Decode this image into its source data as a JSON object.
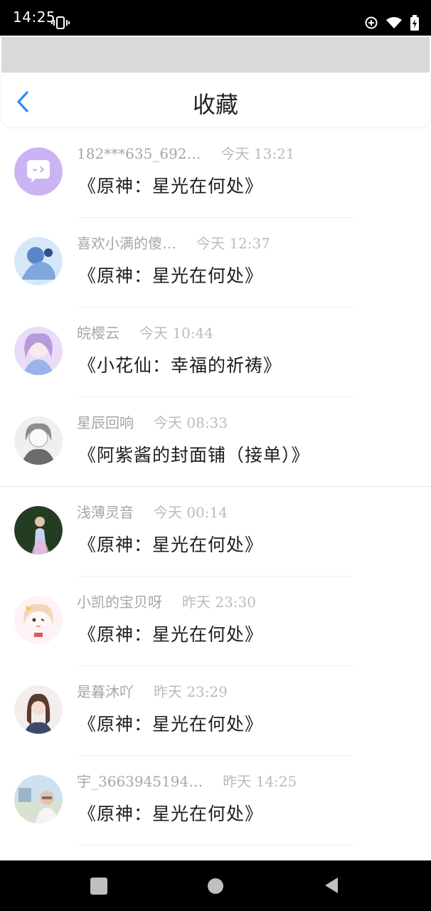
{
  "status_bar": {
    "time": "14:25"
  },
  "header": {
    "title": "收藏"
  },
  "items": [
    {
      "name": "182***635_692…",
      "time": "今天 13:21",
      "work": "《原神：星光在何处》",
      "avatar": "chat-bubble-avatar",
      "colors": [
        "#c9b3f2",
        "#ffffff"
      ]
    },
    {
      "name": "喜欢小满的傻…",
      "time": "今天 12:37",
      "work": "《原神：星光在何处》",
      "avatar": "anime-avatar",
      "colors": [
        "#cfe3f7",
        "#5a86c9"
      ]
    },
    {
      "name": "皖樱云",
      "time": "今天 10:44",
      "work": "《小花仙：幸福的祈祷》",
      "avatar": "anime-avatar",
      "colors": [
        "#e8d6f6",
        "#b59ad8"
      ]
    },
    {
      "name": "星辰回响",
      "time": "今天 08:33",
      "work": "《阿紫酱的封面铺（接单）》",
      "avatar": "anime-avatar",
      "colors": [
        "#ededed",
        "#8c8c8c"
      ]
    },
    {
      "name": "浅薄灵音",
      "time": "今天 00:14",
      "work": "《原神：星光在何处》",
      "avatar": "photo-avatar",
      "colors": [
        "#2e4a2a",
        "#b7c8e8"
      ]
    },
    {
      "name": "小凯的宝贝呀",
      "time": "昨天 23:30",
      "work": "《原神：星光在何处》",
      "avatar": "anime-avatar",
      "colors": [
        "#fbeef2",
        "#f2c7a8"
      ]
    },
    {
      "name": "是暮沐吖",
      "time": "昨天 23:29",
      "work": "《原神：星光在何处》",
      "avatar": "anime-avatar",
      "colors": [
        "#f3efee",
        "#5b3a2f"
      ]
    },
    {
      "name": "宇_3663945194…",
      "time": "昨天 14:25",
      "work": "《原神：星光在何处》",
      "avatar": "photo-avatar",
      "colors": [
        "#c9d9ea",
        "#e8c8b5"
      ]
    }
  ]
}
